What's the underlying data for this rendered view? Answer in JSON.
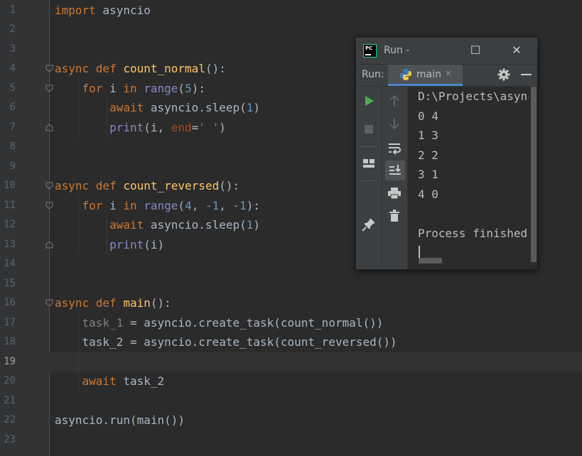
{
  "editor": {
    "current_line": 19,
    "lines": [
      {
        "n": "1",
        "tokens": [
          {
            "t": "import",
            "c": "kw"
          },
          {
            "t": " asyncio",
            "c": ""
          }
        ]
      },
      {
        "n": "2",
        "tokens": []
      },
      {
        "n": "3",
        "tokens": []
      },
      {
        "n": "4",
        "fold": "open",
        "tokens": [
          {
            "t": "async def",
            "c": "kw"
          },
          {
            "t": " ",
            "c": ""
          },
          {
            "t": "count_normal",
            "c": "fn"
          },
          {
            "t": "():",
            "c": ""
          }
        ]
      },
      {
        "n": "5",
        "fold": "open",
        "tokens": [
          {
            "t": "    ",
            "c": ""
          },
          {
            "t": "for",
            "c": "kw"
          },
          {
            "t": " i ",
            "c": ""
          },
          {
            "t": "in",
            "c": "kw"
          },
          {
            "t": " ",
            "c": ""
          },
          {
            "t": "range",
            "c": "bi"
          },
          {
            "t": "(",
            "c": ""
          },
          {
            "t": "5",
            "c": "num"
          },
          {
            "t": "):",
            "c": ""
          }
        ]
      },
      {
        "n": "6",
        "tokens": [
          {
            "t": "        ",
            "c": ""
          },
          {
            "t": "await",
            "c": "kw"
          },
          {
            "t": " asyncio.sleep(",
            "c": ""
          },
          {
            "t": "1",
            "c": "num"
          },
          {
            "t": ")",
            "c": ""
          }
        ]
      },
      {
        "n": "7",
        "fold": "close",
        "tokens": [
          {
            "t": "        ",
            "c": ""
          },
          {
            "t": "print",
            "c": "bi"
          },
          {
            "t": "(i, ",
            "c": ""
          },
          {
            "t": "end",
            "c": "par"
          },
          {
            "t": "=",
            "c": ""
          },
          {
            "t": "' '",
            "c": "str"
          },
          {
            "t": ")",
            "c": ""
          }
        ]
      },
      {
        "n": "8",
        "tokens": []
      },
      {
        "n": "9",
        "tokens": []
      },
      {
        "n": "10",
        "fold": "open",
        "tokens": [
          {
            "t": "async def",
            "c": "kw"
          },
          {
            "t": " ",
            "c": ""
          },
          {
            "t": "count_reversed",
            "c": "fn"
          },
          {
            "t": "():",
            "c": ""
          }
        ]
      },
      {
        "n": "11",
        "fold": "open",
        "tokens": [
          {
            "t": "    ",
            "c": ""
          },
          {
            "t": "for",
            "c": "kw"
          },
          {
            "t": " i ",
            "c": ""
          },
          {
            "t": "in",
            "c": "kw"
          },
          {
            "t": " ",
            "c": ""
          },
          {
            "t": "range",
            "c": "bi"
          },
          {
            "t": "(",
            "c": ""
          },
          {
            "t": "4",
            "c": "num"
          },
          {
            "t": ", ",
            "c": ""
          },
          {
            "t": "-1",
            "c": "num"
          },
          {
            "t": ", ",
            "c": ""
          },
          {
            "t": "-1",
            "c": "num"
          },
          {
            "t": "):",
            "c": ""
          }
        ]
      },
      {
        "n": "12",
        "tokens": [
          {
            "t": "        ",
            "c": ""
          },
          {
            "t": "await",
            "c": "kw"
          },
          {
            "t": " asyncio.sleep(",
            "c": ""
          },
          {
            "t": "1",
            "c": "num"
          },
          {
            "t": ")",
            "c": ""
          }
        ]
      },
      {
        "n": "13",
        "fold": "close",
        "tokens": [
          {
            "t": "        ",
            "c": ""
          },
          {
            "t": "print",
            "c": "bi"
          },
          {
            "t": "(i)",
            "c": ""
          }
        ]
      },
      {
        "n": "14",
        "tokens": []
      },
      {
        "n": "15",
        "tokens": []
      },
      {
        "n": "16",
        "fold": "open",
        "tokens": [
          {
            "t": "async def",
            "c": "kw"
          },
          {
            "t": " ",
            "c": ""
          },
          {
            "t": "main",
            "c": "fn"
          },
          {
            "t": "():",
            "c": ""
          }
        ]
      },
      {
        "n": "17",
        "tokens": [
          {
            "t": "    ",
            "c": ""
          },
          {
            "t": "task_1",
            "c": "mute"
          },
          {
            "t": " = asyncio.create_task(count_normal())",
            "c": ""
          }
        ]
      },
      {
        "n": "18",
        "tokens": [
          {
            "t": "    task_2 = asyncio.create_task(count_reversed())",
            "c": ""
          }
        ]
      },
      {
        "n": "19",
        "tokens": []
      },
      {
        "n": "20",
        "tokens": [
          {
            "t": "    ",
            "c": ""
          },
          {
            "t": "await",
            "c": "kw"
          },
          {
            "t": " task_2",
            "c": ""
          }
        ]
      },
      {
        "n": "21",
        "tokens": []
      },
      {
        "n": "22",
        "tokens": [
          {
            "t": "asyncio.run(main())",
            "c": ""
          }
        ]
      },
      {
        "n": "23",
        "tokens": []
      }
    ]
  },
  "run_window": {
    "title": "Run -",
    "logo_text": "PC",
    "maximize_glyph": "☐",
    "close_glyph": "✕",
    "run_label": "Run:",
    "tab_label": "main",
    "tab_close_glyph": "×",
    "console_lines": [
      "D:\\Projects\\async",
      "0 4",
      "1 3",
      "2 2",
      "3 1",
      "4 0",
      "",
      "Process finished"
    ]
  },
  "colors": {
    "background": "#2b2b2b",
    "keyword": "#cc7832",
    "function": "#ffc66d",
    "builtin": "#8888c6",
    "number": "#6897bb",
    "string": "#6a8759",
    "param": "#aa4926",
    "run_green": "#4caf50",
    "accent_blue": "#4a88c7"
  },
  "icons": {
    "run": "play-icon",
    "stop": "stop-icon",
    "up": "arrow-up-icon",
    "down": "arrow-down-icon",
    "wrap": "soft-wrap-icon",
    "scroll_end": "scroll-to-end-icon",
    "layout": "layout-icon",
    "print": "print-icon",
    "pin": "pin-icon",
    "trash": "trash-icon",
    "settings": "gear-icon",
    "minimize": "minimize-icon",
    "python": "python-icon"
  }
}
